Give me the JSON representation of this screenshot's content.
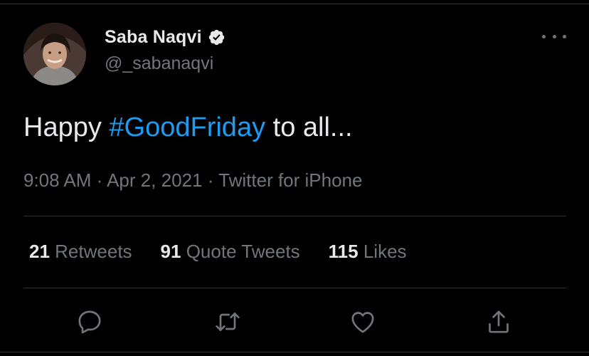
{
  "user": {
    "display_name": "Saba Naqvi",
    "handle": "@_sabanaqvi",
    "verified": true
  },
  "tweet": {
    "text_before": "Happy ",
    "hashtag": "#GoodFriday",
    "text_after": " to all...",
    "time": "9:08 AM",
    "date": "Apr 2, 2021",
    "source": "Twitter for iPhone",
    "separator": " · "
  },
  "stats": {
    "retweets_count": "21",
    "retweets_label": "Retweets",
    "quotes_count": "91",
    "quotes_label": "Quote Tweets",
    "likes_count": "115",
    "likes_label": "Likes"
  },
  "icons": {
    "more": "more-horizontal-icon",
    "reply": "reply-icon",
    "retweet": "retweet-icon",
    "like": "like-icon",
    "share": "share-icon",
    "verified": "verified-badge-icon"
  },
  "colors": {
    "background": "#000000",
    "text_primary": "#e7e9ea",
    "text_secondary": "#71767b",
    "link": "#1d9bf0",
    "divider": "#2f3336"
  }
}
